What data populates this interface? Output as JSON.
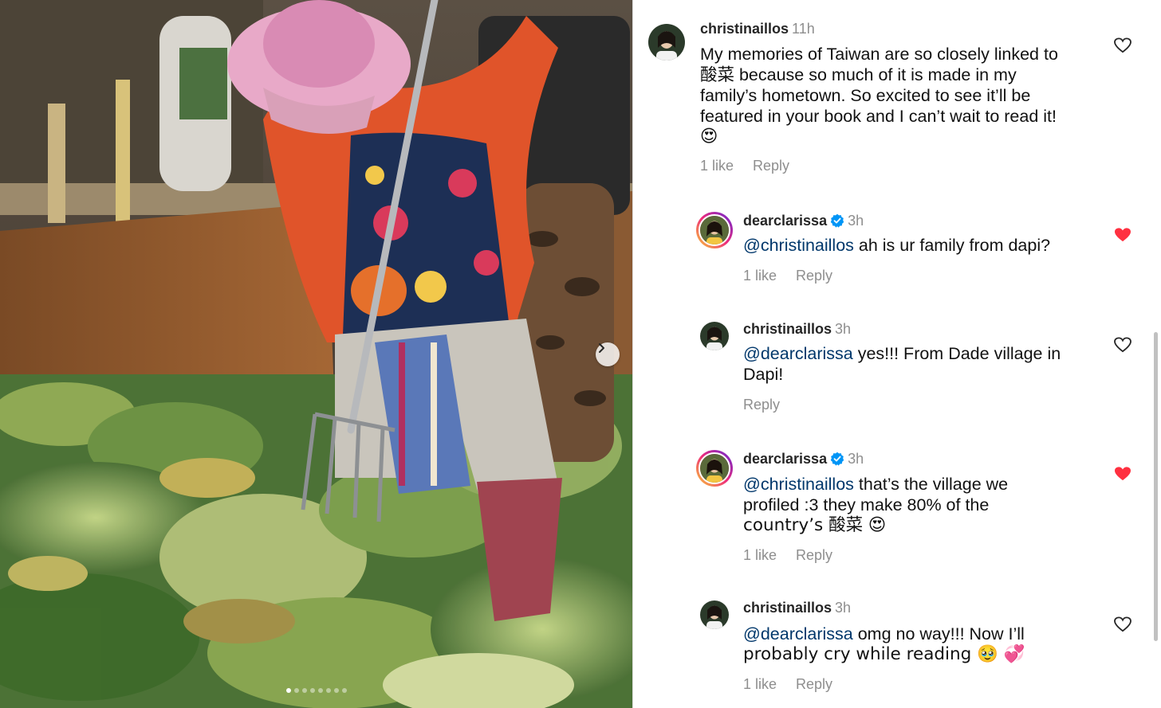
{
  "photo": {
    "slide_count": 8,
    "active_slide": 1
  },
  "colors": {
    "link": "#00376b",
    "muted": "#8e8e8e",
    "liked_heart": "#ff3040",
    "verified": "#0095f6"
  },
  "comments": [
    {
      "username": "christinaillos",
      "time": "11h",
      "verified": false,
      "mention": "",
      "text_lines": [
        "My memories of Taiwan are so closely linked to",
        "酸菜 because so much of it is made in my",
        "family’s hometown. So excited to see it’ll be",
        "featured in your book and I can’t wait to read it!",
        "😍"
      ],
      "likes": "1 like",
      "reply_label": "Reply",
      "liked": false
    },
    {
      "username": "dearclarissa",
      "time": "3h",
      "verified": true,
      "mention": "@christinaillos",
      "text": " ah is ur family from dapi?",
      "likes": "1 like",
      "reply_label": "Reply",
      "liked": true
    },
    {
      "username": "christinaillos",
      "time": "3h",
      "verified": false,
      "mention": "@dearclarissa",
      "text": " yes!!! From Dade village in",
      "text_line2": "Dapi!",
      "likes": "",
      "reply_label": "Reply",
      "liked": false
    },
    {
      "username": "dearclarissa",
      "time": "3h",
      "verified": true,
      "mention": "@christinaillos",
      "text": " that’s the village we",
      "text_line2": "profiled :3 they make 80% of the",
      "text_line3": "country’s 酸菜 😍",
      "likes": "1 like",
      "reply_label": "Reply",
      "liked": true
    },
    {
      "username": "christinaillos",
      "time": "3h",
      "verified": false,
      "mention": "@dearclarissa",
      "text": " omg no way!!! Now I’ll",
      "text_line2": "probably cry while reading 🥹 💞",
      "likes": "1 like",
      "reply_label": "Reply",
      "liked": false
    }
  ]
}
